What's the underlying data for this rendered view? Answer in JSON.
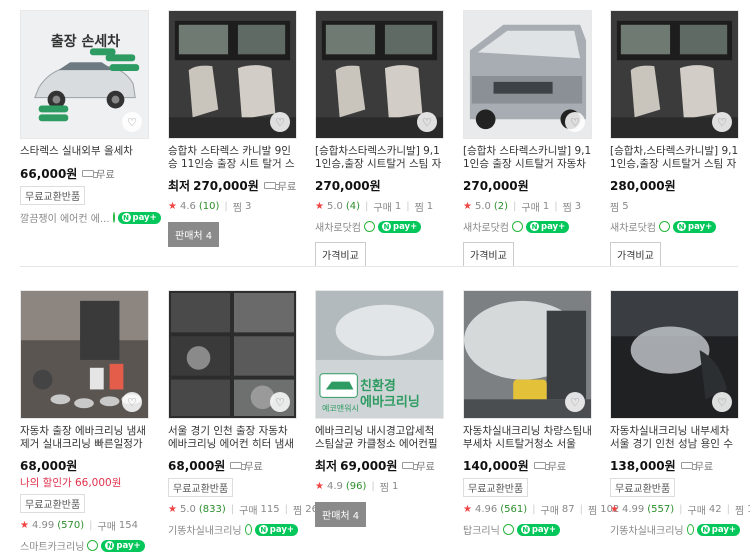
{
  "row1": [
    {
      "title": "스타렉스 실내외부 올세차",
      "thumb_text": "출장 손세차",
      "thumb_tags": [
        "인조가죽",
        "외부세척",
        "유리세척",
        "벌레제거"
      ],
      "price": "66,000원",
      "shipping": "무료",
      "badge": "무료교환반품",
      "store": "깔끔쟁이 에어컨 에...",
      "talk": true,
      "npay": "pay"
    },
    {
      "title": "승합차 스타렉스 카니발 9인승 11인승 출장 시트 탈거 스팀 ...",
      "price_prefix": "최저",
      "price": "270,000원",
      "shipping": "무료",
      "rating": "4.6",
      "reviews": "(10)",
      "zzim_label": "찜",
      "zzim": "3",
      "button": "판매처 4"
    },
    {
      "title": "[승합차스타렉스카니발] 9,11인승,출장 시트탈거 스팀 자동...",
      "price": "270,000원",
      "rating": "5.0",
      "reviews": "(4)",
      "buy_label": "구매",
      "buy": "1",
      "zzim_label": "찜",
      "zzim": "1",
      "store": "새차로닷컴",
      "talk": true,
      "npay": "pay",
      "button": "가격비교"
    },
    {
      "title": "[승합차 스타렉스카니발] 9,11인승 출장 시트탈거 자동차 ...",
      "price": "270,000원",
      "rating": "5.0",
      "reviews": "(2)",
      "buy_label": "구매",
      "buy": "1",
      "zzim_label": "찜",
      "zzim": "3",
      "store": "새차로닷컴",
      "talk": true,
      "npay": "pay",
      "button": "가격비교"
    },
    {
      "title": "[승합차,스타렉스카니발] 9,11인승,출장 시트탈거 스팀 자동...",
      "price": "280,000원",
      "zzim_label": "찜",
      "zzim": "5",
      "store": "새차로닷컴",
      "talk": true,
      "npay": "pay",
      "button": "가격비교"
    }
  ],
  "row2": [
    {
      "title": "자동차 출장 에바크리닝 냄새제거 실내크리닝 빠른일정가능 ...",
      "price": "68,000원",
      "discount": "나의 할인가 66,000원",
      "badge": "무료교환반품",
      "rating": "4.99",
      "reviews": "(570)",
      "buy_label": "구매",
      "buy": "154",
      "store": "스마트카크리닝",
      "talk": true,
      "npay": "pay"
    },
    {
      "title": "서울 경기 인천 출장 자동차 에바크리닝 에어컨 히터 냄새 ...",
      "price": "68,000원",
      "shipping": "무료",
      "badge": "무료교환반품",
      "rating": "5.0",
      "reviews": "(833)",
      "buy_label": "구매",
      "buy": "115",
      "zzim_label": "찜",
      "zzim": "261",
      "store": "기똥차실내크리닝",
      "talk": true,
      "npay": "pay"
    },
    {
      "title": "에바크리닝 내시경고압세척 스팀살균 카클청소 에어컨필터...",
      "thumb_text1": "친환경",
      "thumb_text2": "에바크리닝",
      "thumb_text3": "예코맨워시",
      "price_prefix": "최저",
      "price": "69,000원",
      "shipping": "무료",
      "rating": "4.9",
      "reviews": "(96)",
      "zzim_label": "찜",
      "zzim": "1",
      "button": "판매처 4"
    },
    {
      "title": "자동차실내크리닝 차량스팀내부세차 시트탈거청소 서울인...",
      "price": "140,000원",
      "shipping": "무료",
      "badge": "무료교환반품",
      "rating": "4.96",
      "reviews": "(561)",
      "buy_label": "구매",
      "buy": "87",
      "zzim_label": "찜",
      "zzim": "102",
      "store": "탑크리닉",
      "talk": true,
      "npay": "pay"
    },
    {
      "title": "자동차실내크리닝 내부세차 서울 경기 인천 성남 용인 수원 ...",
      "price": "138,000원",
      "shipping": "무료",
      "badge": "무료교환반품",
      "rating": "4.99",
      "reviews": "(557)",
      "buy_label": "구매",
      "buy": "42",
      "zzim_label": "찜",
      "zzim": "120",
      "store": "기똥차실내크리닝",
      "talk": true,
      "npay": "pay"
    }
  ],
  "colors": {
    "price": "#111111",
    "discount": "#e0314b",
    "rating_star": "#f04545",
    "npay_green": "#03c75a"
  }
}
